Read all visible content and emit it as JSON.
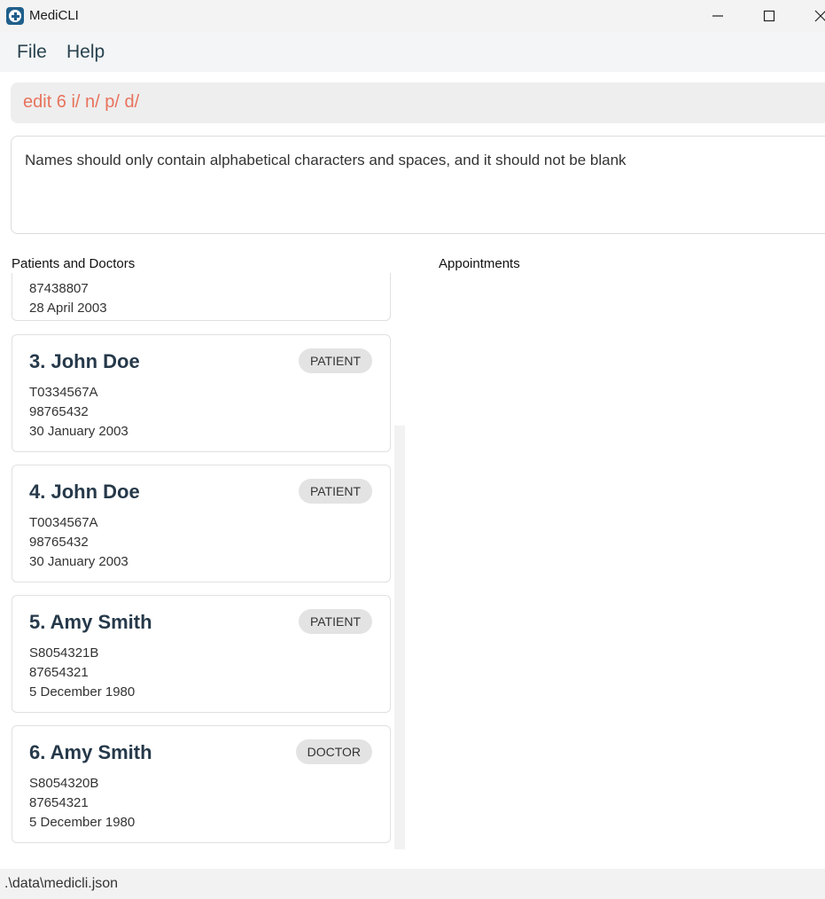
{
  "window": {
    "title": "MediCLI",
    "icon": "medical-cross-icon"
  },
  "menu": {
    "file": "File",
    "help": "Help"
  },
  "command": {
    "value": "edit 6 i/ n/ p/ d/",
    "error_color": "#e8735d"
  },
  "result": {
    "message": "Names should only contain alphabetical characters and spaces, and it should not be blank"
  },
  "sections": {
    "persons": "Patients and Doctors",
    "appointments": "Appointments"
  },
  "partial_card": {
    "phone": "87438807",
    "dob": "28 April 2003"
  },
  "persons": [
    {
      "index": "3.",
      "name": "John Doe",
      "type": "PATIENT",
      "nric": "T0334567A",
      "phone": "98765432",
      "dob": "30 January 2003"
    },
    {
      "index": "4.",
      "name": "John Doe",
      "type": "PATIENT",
      "nric": "T0034567A",
      "phone": "98765432",
      "dob": "30 January 2003"
    },
    {
      "index": "5.",
      "name": "Amy Smith",
      "type": "PATIENT",
      "nric": "S8054321B",
      "phone": "87654321",
      "dob": "5 December 1980"
    },
    {
      "index": "6.",
      "name": "Amy Smith",
      "type": "DOCTOR",
      "nric": "S8054320B",
      "phone": "87654321",
      "dob": "5 December 1980"
    }
  ],
  "card_names": {
    "p0": "3.  John Doe",
    "p1": "4.  John Doe",
    "p2": "5.  Amy Smith",
    "p3": "6.  Amy Smith"
  },
  "status": {
    "path": ".\\data\\medicli.json"
  }
}
